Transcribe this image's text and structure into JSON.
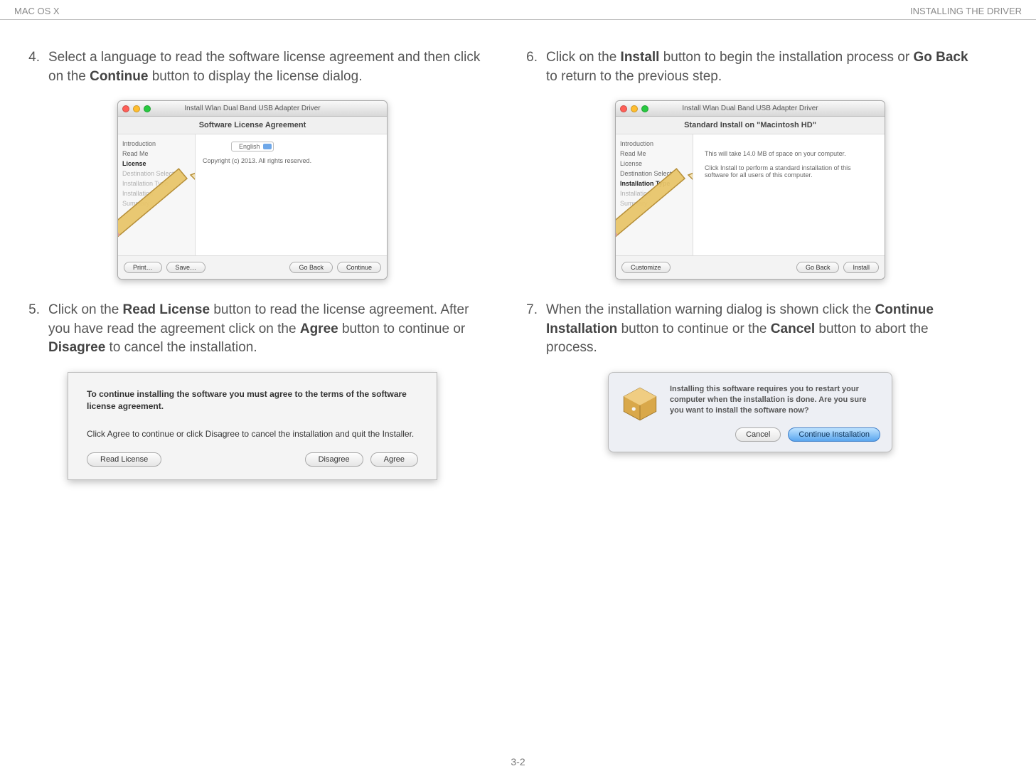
{
  "header": {
    "left": "MAC OS X",
    "right": "INSTALLING THE DRIVER"
  },
  "page_number": "3-2",
  "step4": {
    "num": "4.",
    "text_pre": "Select a language to read the software license agreement and then click on the ",
    "bold1": "Continue",
    "text_post": " button to display the license dialog."
  },
  "step5": {
    "num": "5.",
    "p1": "Click on the ",
    "b1": "Read License",
    "p2": " button to read the license agreement. After you have read the agreement click on the ",
    "b2": "Agree",
    "p3": " button to continue or ",
    "b3": "Disagree",
    "p4": " to cancel the installation."
  },
  "step6": {
    "num": "6.",
    "p1": "Click on the ",
    "b1": "Install",
    "p2": " button to begin the installation process or ",
    "b2": "Go Back",
    "p3": " to return to the previous step."
  },
  "step7": {
    "num": "7.",
    "p1": "When the installation warning dialog is shown click the ",
    "b1": "Continue Installation",
    "p2": " button to continue or the ",
    "b2": "Cancel",
    "p3": " button to abort the process."
  },
  "fig4": {
    "window_title": "Install Wlan Dual Band USB Adapter Driver",
    "subtitle": "Software License Agreement",
    "sidebar": [
      "Introduction",
      "Read Me",
      "License",
      "Destination Select",
      "Installation Type",
      "Installation",
      "Summary"
    ],
    "language": "English",
    "copyright": "Copyright (c) 2013.  All rights reserved.",
    "buttons": {
      "print": "Print…",
      "save": "Save…",
      "back": "Go Back",
      "cont": "Continue"
    }
  },
  "fig5": {
    "heading": "To continue installing the software you must agree to the terms of the software license agreement.",
    "sub": "Click Agree to continue or click Disagree to cancel the installation and quit the Installer.",
    "read": "Read License",
    "disagree": "Disagree",
    "agree": "Agree"
  },
  "fig6": {
    "window_title": "Install Wlan Dual Band USB Adapter Driver",
    "subtitle": "Standard Install on \"Macintosh HD\"",
    "sidebar": [
      "Introduction",
      "Read Me",
      "License",
      "Destination Select",
      "Installation Type",
      "Installation",
      "Summary"
    ],
    "line1": "This will take 14.0 MB of space on your computer.",
    "line2": "Click Install to perform a standard installation of this software for all users of this computer.",
    "buttons": {
      "customize": "Customize",
      "back": "Go Back",
      "install": "Install"
    }
  },
  "fig7": {
    "msg": "Installing this software requires you to restart your computer when the installation is done. Are you sure you want to install the software now?",
    "cancel": "Cancel",
    "cont": "Continue Installation"
  }
}
